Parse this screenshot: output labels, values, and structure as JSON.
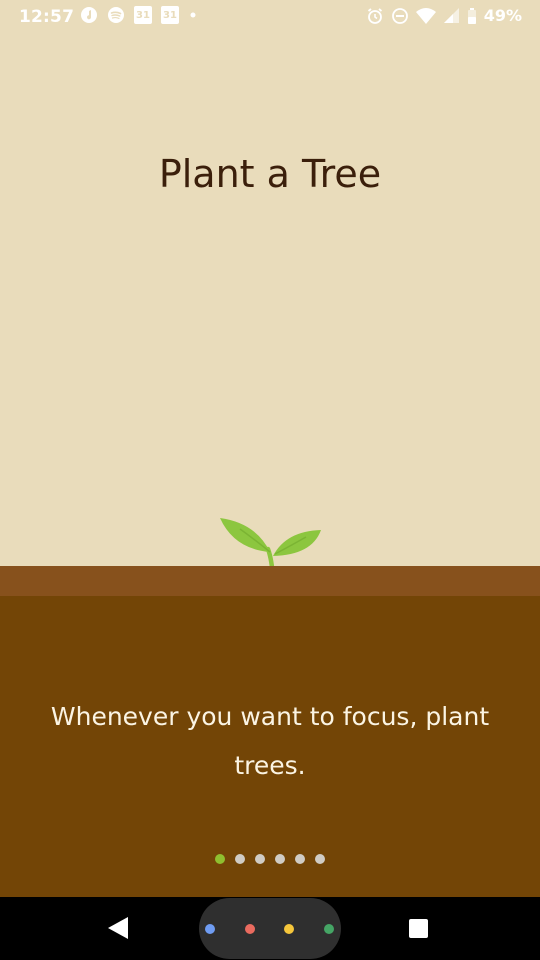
{
  "status_bar": {
    "time": "12:57",
    "battery": "49%",
    "left_icons": [
      "music-icon",
      "spotify-icon",
      "calendar-icon",
      "calendar-icon",
      "dot-icon"
    ],
    "calendar_label": "31",
    "right_icons": [
      "alarm-icon",
      "do-not-disturb-icon",
      "wifi-icon",
      "signal-icon",
      "battery-icon"
    ]
  },
  "onboarding": {
    "title": "Plant a Tree",
    "description": "Whenever you want to focus, plant trees.",
    "page_count": 6,
    "active_page": 1
  },
  "colors": {
    "sky": "#e9dcbb",
    "ground_top": "#87511c",
    "ground": "#734506",
    "title_text": "#3b1f0b",
    "description_text": "#fbf4e3",
    "dot_active": "#8fbf2f",
    "dot_inactive": "#d0ccc4",
    "sprout": "#8cc63f"
  },
  "nav_bar": {
    "icons": [
      "back-icon",
      "home-button",
      "recents-icon"
    ],
    "assistant_dot_colors": [
      "#6f9cf2",
      "#ea6b5f",
      "#f5c63b",
      "#45a565"
    ]
  }
}
